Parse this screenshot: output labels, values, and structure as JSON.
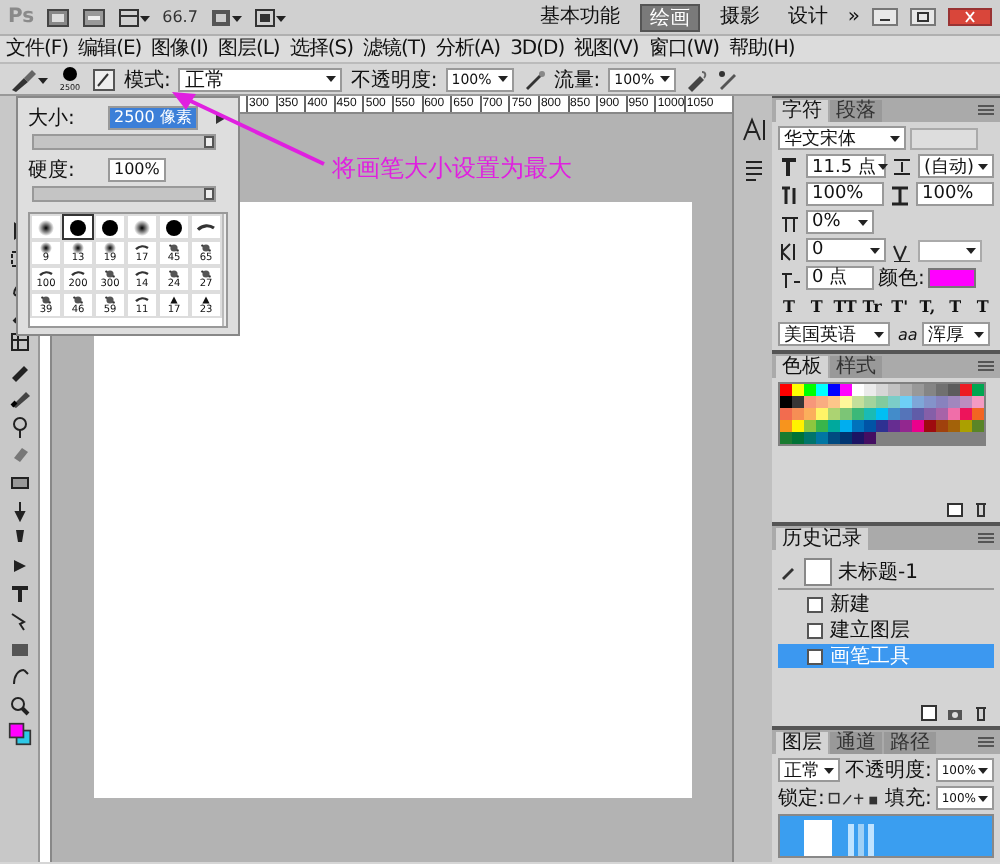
{
  "app_bar": {
    "logo": "Ps",
    "zoom": "66.7",
    "workspaces": [
      {
        "label": "基本功能",
        "selected": false
      },
      {
        "label": "绘画",
        "selected": true
      },
      {
        "label": "摄影",
        "selected": false
      },
      {
        "label": "设计",
        "selected": false
      }
    ],
    "more": "»"
  },
  "menu": [
    "文件(F)",
    "编辑(E)",
    "图像(I)",
    "图层(L)",
    "选择(S)",
    "滤镜(T)",
    "分析(A)",
    "3D(D)",
    "视图(V)",
    "窗口(W)",
    "帮助(H)"
  ],
  "options_bar": {
    "brush_size": "2500",
    "mode_label": "模式:",
    "mode": "正常",
    "opacity_label": "不透明度:",
    "opacity": "100%",
    "flow_label": "流量:",
    "flow": "100%"
  },
  "ruler": [
    "300",
    "350",
    "400",
    "450",
    "500",
    "550",
    "600",
    "650",
    "700",
    "750",
    "800",
    "850",
    "900",
    "950",
    "1000",
    "1050"
  ],
  "brush_popup": {
    "size_label": "大小:",
    "size": "2500 像素",
    "size_slider": {
      "level": 1
    },
    "hardness_label": "硬度:",
    "hardness": "100%",
    "hardness_slider": {
      "level": 1
    },
    "presets": [
      {
        "kind": "soft",
        "selected": false
      },
      {
        "kind": "hard",
        "selected": true
      },
      {
        "kind": "hard",
        "selected": false
      },
      {
        "kind": "soft",
        "selected": false
      },
      {
        "kind": "hard",
        "selected": false
      },
      {
        "kind": "stroke",
        "selected": false
      },
      {
        "kind": "soft",
        "label": "9",
        "selected": false
      },
      {
        "kind": "soft",
        "label": "13",
        "selected": false
      },
      {
        "kind": "soft",
        "label": "19",
        "selected": false
      },
      {
        "kind": "stroke",
        "label": "17",
        "selected": false
      },
      {
        "kind": "splat",
        "label": "45",
        "selected": false
      },
      {
        "kind": "splat",
        "label": "65",
        "selected": false
      },
      {
        "kind": "stroke",
        "label": "100",
        "selected": false
      },
      {
        "kind": "stroke",
        "label": "200",
        "selected": false
      },
      {
        "kind": "splat",
        "label": "300",
        "selected": false
      },
      {
        "kind": "stroke",
        "label": "14",
        "selected": false
      },
      {
        "kind": "splat",
        "label": "24",
        "selected": false
      },
      {
        "kind": "splat",
        "label": "27",
        "selected": false
      },
      {
        "kind": "splat",
        "label": "39",
        "selected": false
      },
      {
        "kind": "splat",
        "label": "46",
        "selected": false
      },
      {
        "kind": "splat",
        "label": "59",
        "selected": false
      },
      {
        "kind": "stroke",
        "label": "11",
        "selected": false
      },
      {
        "kind": "leaf",
        "label": "17",
        "selected": false
      },
      {
        "kind": "leaf",
        "label": "23",
        "selected": false
      }
    ]
  },
  "annotation": "将画笔大小设置为最大",
  "character_panel": {
    "tabs": [
      {
        "label": "字符",
        "selected": true
      },
      {
        "label": "段落",
        "selected": false
      }
    ],
    "font": "华文宋体",
    "size": "11.5 点",
    "leading": "(自动)",
    "vertical_scale": "100%",
    "horizontal_scale": "100%",
    "tsume": "0%",
    "tracking": "0",
    "baseline": "0 点",
    "color_label": "颜色:",
    "color": "#ff00ff",
    "style_buttons": [
      "T",
      "T",
      "TT",
      "Tr",
      "T'",
      "T,",
      "T",
      "T"
    ],
    "language": "美国英语",
    "antialias_icon": "aa",
    "antialias": "浑厚"
  },
  "swatches_panel": {
    "tabs": [
      {
        "label": "色板",
        "selected": true
      },
      {
        "label": "样式",
        "selected": false
      }
    ],
    "swatches": [
      {
        "color": "#ff0000"
      },
      {
        "color": "#ffff00"
      },
      {
        "color": "#00ff00"
      },
      {
        "color": "#00ffff"
      },
      {
        "color": "#0000ff"
      },
      {
        "color": "#ff00ff"
      },
      {
        "color": "#ffffff"
      },
      {
        "color": "#ebebeb"
      },
      {
        "color": "#d6d6d6"
      },
      {
        "color": "#c2c2c2"
      },
      {
        "color": "#adadad"
      },
      {
        "color": "#999999"
      },
      {
        "color": "#858585"
      },
      {
        "color": "#707070"
      },
      {
        "color": "#5c5c5c"
      },
      {
        "color": "#ed1c24"
      },
      {
        "color": "#00a651"
      },
      {
        "color": "#000000"
      },
      {
        "color": "#363636"
      },
      {
        "color": "#f7977a"
      },
      {
        "color": "#f9ad81"
      },
      {
        "color": "#fdc68a"
      },
      {
        "color": "#fff79a"
      },
      {
        "color": "#c4df9b"
      },
      {
        "color": "#a3d39c"
      },
      {
        "color": "#82ca9d"
      },
      {
        "color": "#7bcdc8"
      },
      {
        "color": "#6ecff6"
      },
      {
        "color": "#7ea7d8"
      },
      {
        "color": "#8493ca"
      },
      {
        "color": "#8882be"
      },
      {
        "color": "#a187be"
      },
      {
        "color": "#bc8dbf"
      },
      {
        "color": "#f49ac2"
      },
      {
        "color": "#f26c4f"
      },
      {
        "color": "#f68e55"
      },
      {
        "color": "#fbaf5c"
      },
      {
        "color": "#fff467"
      },
      {
        "color": "#acd372"
      },
      {
        "color": "#7cc576"
      },
      {
        "color": "#3bb878"
      },
      {
        "color": "#1abbb4"
      },
      {
        "color": "#00bff3"
      },
      {
        "color": "#438cca"
      },
      {
        "color": "#5574b9"
      },
      {
        "color": "#605ca8"
      },
      {
        "color": "#855fa8"
      },
      {
        "color": "#a763a8"
      },
      {
        "color": "#f06ea9"
      },
      {
        "color": "#ed145b"
      },
      {
        "color": "#f26522"
      },
      {
        "color": "#f7941d"
      },
      {
        "color": "#fff200"
      },
      {
        "color": "#8dc73f"
      },
      {
        "color": "#39b54a"
      },
      {
        "color": "#00a99d"
      },
      {
        "color": "#00aeef"
      },
      {
        "color": "#0072bc"
      },
      {
        "color": "#0054a6"
      },
      {
        "color": "#2e3192"
      },
      {
        "color": "#662d91"
      },
      {
        "color": "#92278f"
      },
      {
        "color": "#ec008c"
      },
      {
        "color": "#9e0b0f"
      },
      {
        "color": "#a0410d"
      },
      {
        "color": "#a36209"
      },
      {
        "color": "#aba000"
      },
      {
        "color": "#598527"
      },
      {
        "color": "#197b30"
      },
      {
        "color": "#007236"
      },
      {
        "color": "#00746b"
      },
      {
        "color": "#0076a3"
      },
      {
        "color": "#004a80"
      },
      {
        "color": "#003471"
      },
      {
        "color": "#1b1464"
      },
      {
        "color": "#440e62"
      }
    ]
  },
  "history_panel": {
    "tabs": [
      {
        "label": "历史记录",
        "selected": true
      }
    ],
    "snapshot": "未标题-1",
    "steps": [
      {
        "label": "新建",
        "selected": false
      },
      {
        "label": "建立图层",
        "selected": false
      },
      {
        "label": "画笔工具",
        "selected": true
      }
    ]
  },
  "layers_panel": {
    "tabs": [
      {
        "label": "图层",
        "selected": true
      },
      {
        "label": "通道",
        "selected": false
      },
      {
        "label": "路径",
        "selected": false
      }
    ],
    "blend_mode": "正常",
    "opacity_label": "不透明度:",
    "opacity": "100%",
    "lock_label": "锁定:",
    "fill_label": "填充:",
    "fill": "100%"
  }
}
